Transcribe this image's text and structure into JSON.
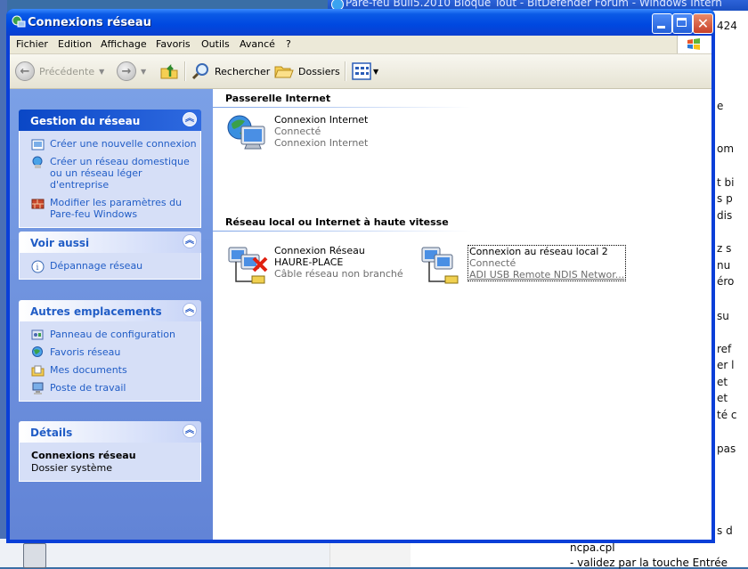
{
  "window": {
    "title": "Connexions réseau"
  },
  "menu": [
    "Fichier",
    "Edition",
    "Affichage",
    "Favoris",
    "Outils",
    "Avancé",
    "?"
  ],
  "toolbar": {
    "back_label": "Précédente",
    "search_label": "Rechercher",
    "folders_label": "Dossiers"
  },
  "taskpane": {
    "network_tasks": {
      "title": "Gestion du réseau",
      "items": [
        "Créer une nouvelle connexion",
        "Créer un réseau domestique ou un réseau léger d'entreprise",
        "Modifier les paramètres du Pare-feu Windows"
      ]
    },
    "see_also": {
      "title": "Voir aussi",
      "items": [
        "Dépannage réseau"
      ]
    },
    "other_places": {
      "title": "Autres emplacements",
      "items": [
        "Panneau de configuration",
        "Favoris réseau",
        "Mes documents",
        "Poste de travail"
      ]
    },
    "details": {
      "title": "Détails",
      "name": "Connexions réseau",
      "type": "Dossier système"
    }
  },
  "groups": {
    "gateway": {
      "title": "Passerelle Internet",
      "items": [
        {
          "name": "Connexion Internet",
          "status": "Connecté",
          "device": "Connexion Internet"
        }
      ]
    },
    "lan": {
      "title": "Réseau local ou Internet à haute vitesse",
      "items": [
        {
          "name": "Connexion Réseau",
          "name2": "HAURE-PLACE",
          "status": "Câble réseau non branché"
        },
        {
          "name": "Connexion au réseau local 2",
          "status": "Connecté",
          "device": "ADI USB Remote NDIS Networ..."
        }
      ]
    }
  },
  "background": {
    "browser_title": "Pare-feu Bull5.2010 Bloque Tout - BitDefender Forum - Windows Intern",
    "right_fragments": [
      "424",
      "e",
      "om",
      "t bi",
      "s p",
      "dis",
      "z s",
      "nu",
      "éro",
      "su",
      "ref",
      "er l",
      "et",
      "et",
      "té c",
      "pas",
      "s d"
    ],
    "bottom_lines": [
      "ncpa.cpl",
      "- validez par la touche Entrée"
    ]
  },
  "colors": {
    "title_blue": "#0a3fd8",
    "task_link": "#215dc6",
    "pane_blue": "#7ba0e6"
  }
}
